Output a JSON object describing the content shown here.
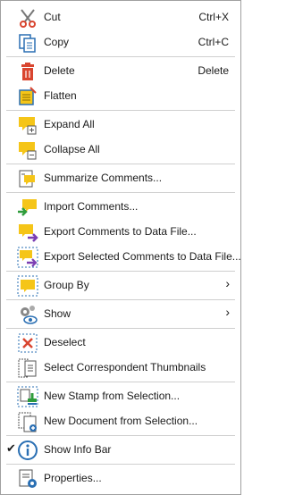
{
  "menu": {
    "cut": {
      "label": "Cut",
      "shortcut": "Ctrl+X",
      "icon": "scissors-icon"
    },
    "copy": {
      "label": "Copy",
      "shortcut": "Ctrl+C",
      "icon": "copy-icon"
    },
    "delete": {
      "label": "Delete",
      "shortcut": "Delete",
      "icon": "trash-icon"
    },
    "flatten": {
      "label": "Flatten",
      "icon": "flatten-icon"
    },
    "expand_all": {
      "label": "Expand All",
      "icon": "expand-comments-icon"
    },
    "collapse_all": {
      "label": "Collapse All",
      "icon": "collapse-comments-icon"
    },
    "summarize": {
      "label": "Summarize Comments...",
      "icon": "summarize-comments-icon"
    },
    "import": {
      "label": "Import Comments...",
      "icon": "import-comments-icon"
    },
    "export": {
      "label": "Export Comments to Data File...",
      "icon": "export-comments-icon"
    },
    "export_selected": {
      "label": "Export Selected Comments to Data File...",
      "icon": "export-selected-comments-icon"
    },
    "group_by": {
      "label": "Group By",
      "icon": "group-by-icon",
      "submenu": true
    },
    "show": {
      "label": "Show",
      "icon": "show-settings-icon",
      "submenu": true
    },
    "deselect": {
      "label": "Deselect",
      "icon": "deselect-icon"
    },
    "select_thumbnails": {
      "label": "Select Correspondent Thumbnails",
      "icon": "select-thumbnails-icon"
    },
    "new_stamp": {
      "label": "New Stamp from Selection...",
      "icon": "new-stamp-icon"
    },
    "new_document": {
      "label": "New Document from Selection...",
      "icon": "new-document-icon"
    },
    "show_info_bar": {
      "label": "Show Info Bar",
      "icon": "info-icon",
      "checked": true,
      "check_glyph": "✔"
    },
    "properties": {
      "label": "Properties...",
      "icon": "properties-icon"
    },
    "submenu_glyph": "›"
  },
  "colors": {
    "accent_yellow": "#f5c518",
    "icon_blue": "#2a6fb3",
    "delete_red": "#d9452f",
    "border": "#a0a0a0",
    "separator": "#cfcfcf"
  }
}
